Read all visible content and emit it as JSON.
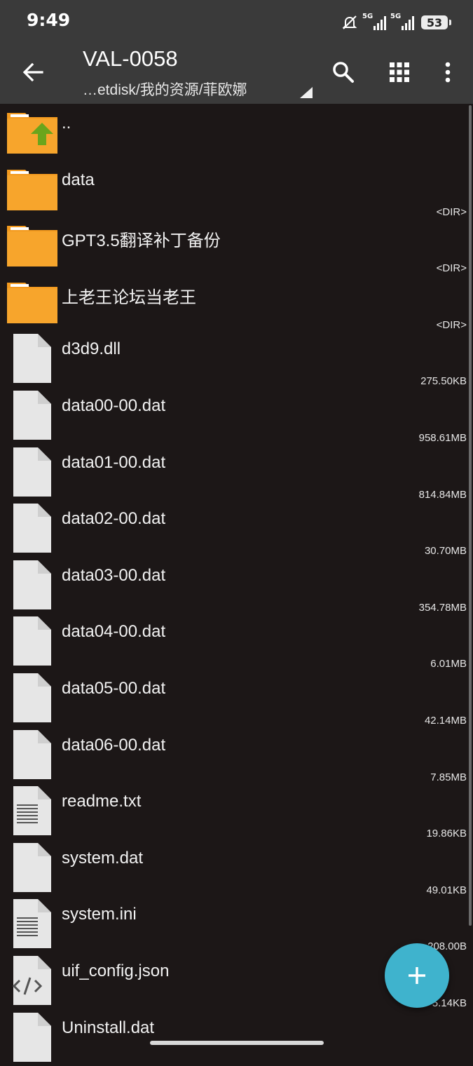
{
  "status_bar": {
    "time": "9:49",
    "signal1_label": "5G",
    "signal2_label": "5G",
    "battery": "53"
  },
  "toolbar": {
    "title": "VAL-0058",
    "path": "…etdisk/我的资源/菲欧娜",
    "icons": [
      "back-arrow-icon",
      "search-icon",
      "grid-view-icon",
      "more-vert-icon"
    ]
  },
  "files": [
    {
      "name": "..",
      "size": "",
      "type": "parent"
    },
    {
      "name": "data",
      "size": "<DIR>",
      "type": "folder"
    },
    {
      "name": "GPT3.5翻译补丁备份",
      "size": "<DIR>",
      "type": "folder"
    },
    {
      "name": "上老王论坛当老王",
      "size": "<DIR>",
      "type": "folder"
    },
    {
      "name": "d3d9.dll",
      "size": "275.50KB",
      "type": "file"
    },
    {
      "name": "data00-00.dat",
      "size": "958.61MB",
      "type": "file"
    },
    {
      "name": "data01-00.dat",
      "size": "814.84MB",
      "type": "file"
    },
    {
      "name": "data02-00.dat",
      "size": "30.70MB",
      "type": "file"
    },
    {
      "name": "data03-00.dat",
      "size": "354.78MB",
      "type": "file"
    },
    {
      "name": "data04-00.dat",
      "size": "6.01MB",
      "type": "file"
    },
    {
      "name": "data05-00.dat",
      "size": "42.14MB",
      "type": "file"
    },
    {
      "name": "data06-00.dat",
      "size": "7.85MB",
      "type": "file"
    },
    {
      "name": "readme.txt",
      "size": "19.86KB",
      "type": "text"
    },
    {
      "name": "system.dat",
      "size": "49.01KB",
      "type": "file"
    },
    {
      "name": "system.ini",
      "size": "208.00B",
      "type": "text"
    },
    {
      "name": "uif_config.json",
      "size": "5.14KB",
      "type": "code"
    },
    {
      "name": "Uninstall.dat",
      "size": "",
      "type": "file"
    }
  ],
  "colors": {
    "background": "#1c1717",
    "toolbar": "#3a3a3a",
    "folder": "#f7a52c",
    "fab": "#3fb3cd",
    "parent_arrow": "#6aa51c"
  }
}
